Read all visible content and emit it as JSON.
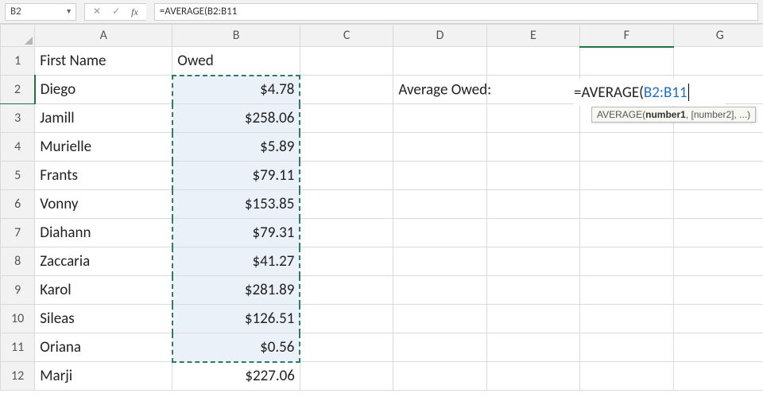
{
  "formula_bar": {
    "name_box": "B2",
    "cancel_icon": "✕",
    "enter_icon": "✓",
    "fx_icon": "fx",
    "formula_text": "=AVERAGE(B2:B11"
  },
  "columns": [
    "A",
    "B",
    "C",
    "D",
    "E",
    "F",
    "G"
  ],
  "headers": {
    "A": "First Name",
    "B": "Owed"
  },
  "rows": [
    {
      "n": 1
    },
    {
      "n": 2,
      "A": "Diego",
      "B": "$4.78"
    },
    {
      "n": 3,
      "A": "Jamill",
      "B": "$258.06"
    },
    {
      "n": 4,
      "A": "Murielle",
      "B": "$5.89"
    },
    {
      "n": 5,
      "A": "Frants",
      "B": "$79.11"
    },
    {
      "n": 6,
      "A": "Vonny",
      "B": "$153.85"
    },
    {
      "n": 7,
      "A": "Diahann",
      "B": "$79.31"
    },
    {
      "n": 8,
      "A": "Zaccaria",
      "B": "$41.27"
    },
    {
      "n": 9,
      "A": "Karol",
      "B": "$281.89"
    },
    {
      "n": 10,
      "A": "Sileas",
      "B": "$126.51"
    },
    {
      "n": 11,
      "A": "Oriana",
      "B": "$0.56"
    },
    {
      "n": 12,
      "A": "Marji",
      "B": "$227.06"
    }
  ],
  "label_cell": "Average Owed:",
  "editing": {
    "prefix": "=AVERAGE(",
    "range": "B2:B11"
  },
  "tooltip": {
    "fn": "AVERAGE(",
    "arg_bold": "number1",
    "rest": ", [number2], ...)"
  },
  "chart_data": {
    "type": "table",
    "columns": [
      "First Name",
      "Owed"
    ],
    "records": [
      [
        "Diego",
        4.78
      ],
      [
        "Jamill",
        258.06
      ],
      [
        "Murielle",
        5.89
      ],
      [
        "Frants",
        79.11
      ],
      [
        "Vonny",
        153.85
      ],
      [
        "Diahann",
        79.31
      ],
      [
        "Zaccaria",
        41.27
      ],
      [
        "Karol",
        281.89
      ],
      [
        "Sileas",
        126.51
      ],
      [
        "Oriana",
        0.56
      ],
      [
        "Marji",
        227.06
      ]
    ],
    "annotations": {
      "label": "Average Owed:",
      "formula_in_progress": "=AVERAGE(B2:B11"
    }
  }
}
